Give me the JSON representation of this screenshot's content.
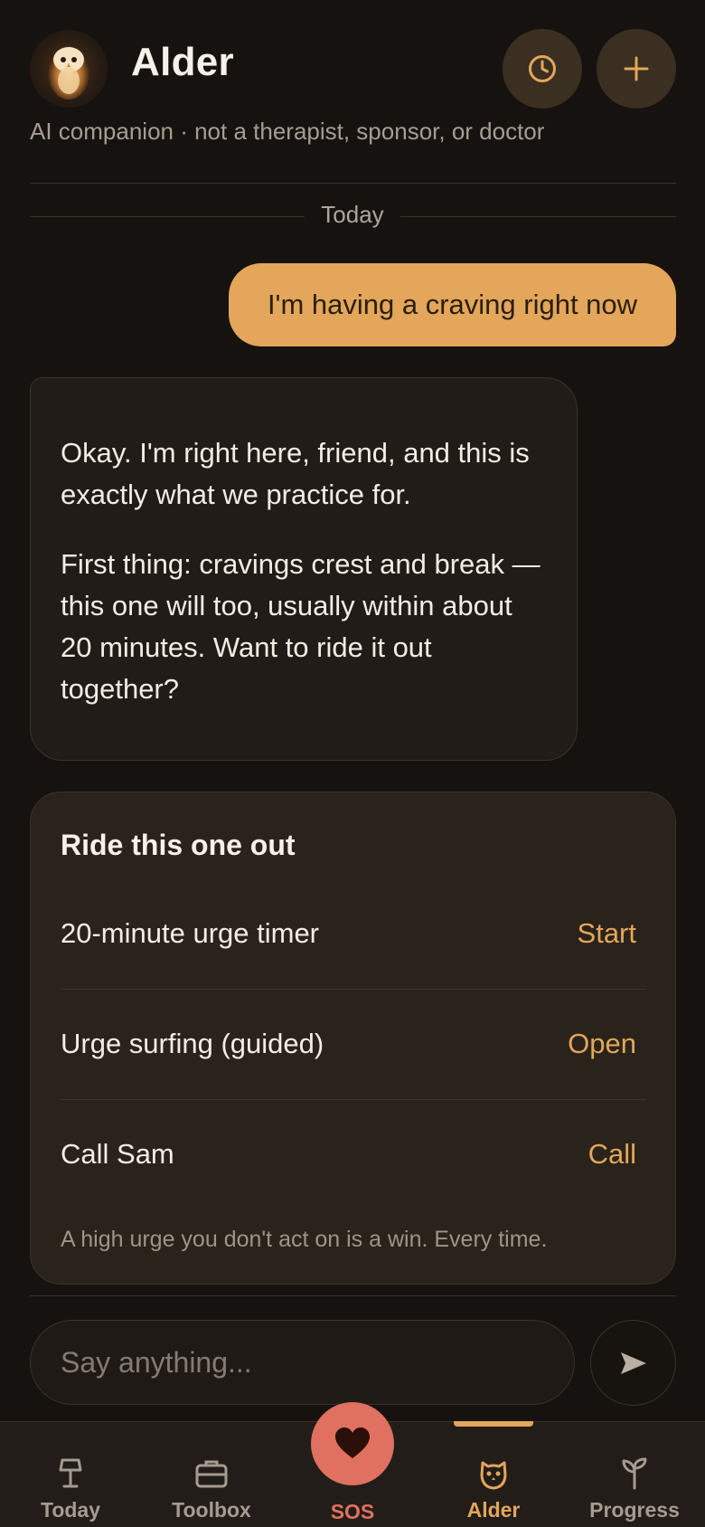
{
  "header": {
    "title": "Alder",
    "avatar_icon": "owl-avatar",
    "history_icon": "clock-icon",
    "new_icon": "plus-icon",
    "disclaimer": "AI companion · not a therapist, sponsor, or doctor"
  },
  "chat": {
    "date_label": "Today",
    "user_message": "I'm having a craving right now",
    "assistant_paragraphs": [
      "Okay. I'm right here, friend, and this is exactly what we practice for.",
      "First thing: cravings crest and break — this one will too, usually within about 20 minutes. Want to ride it out together?"
    ]
  },
  "card": {
    "title": "Ride this one out",
    "rows": [
      {
        "label": "20-minute urge timer",
        "action": "Start"
      },
      {
        "label": "Urge surfing (guided)",
        "action": "Open"
      },
      {
        "label": "Call Sam",
        "action": "Call"
      }
    ],
    "footer": "A high urge you don't act on is a win. Every time."
  },
  "composer": {
    "placeholder": "Say anything...",
    "value": "",
    "send_icon": "send-icon"
  },
  "tabs": [
    {
      "label": "Today",
      "icon": "lamp-icon",
      "active": false
    },
    {
      "label": "Toolbox",
      "icon": "toolbox-icon",
      "active": false
    },
    {
      "label": "SOS",
      "icon": "heart-icon",
      "active": false
    },
    {
      "label": "Alder",
      "icon": "owl-icon",
      "active": true
    },
    {
      "label": "Progress",
      "icon": "sprout-icon",
      "active": false
    }
  ],
  "colors": {
    "background": "#15120f",
    "accent": "#e3a65a",
    "sos": "#e0705f",
    "card": "#2a231b"
  }
}
